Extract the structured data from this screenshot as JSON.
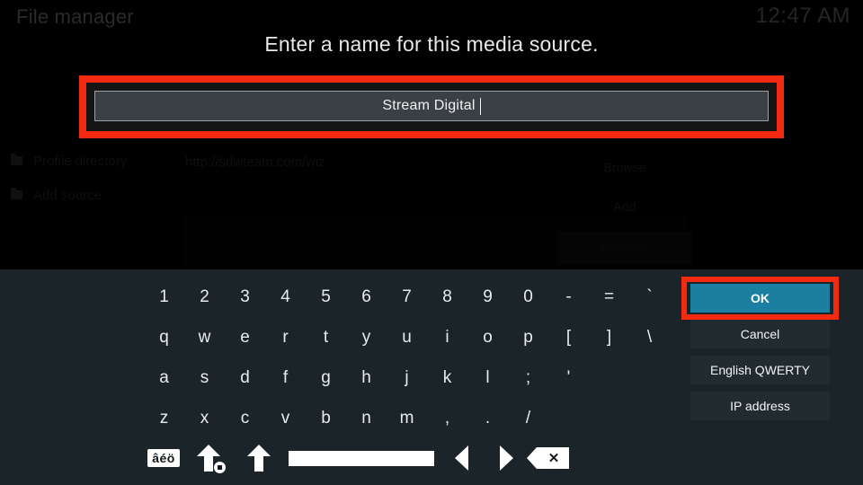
{
  "window": {
    "title": "File manager",
    "clock": "12:47 AM"
  },
  "background": {
    "sidebar_items": [
      {
        "label": "Profile directory",
        "icon": "folder-icon"
      },
      {
        "label": "Add source",
        "icon": "folder-icon"
      }
    ],
    "path_value": "http://sdwteam.com/wiz",
    "buttons": [
      {
        "label": "Browse"
      },
      {
        "label": "Add"
      },
      {
        "label": "Remove"
      }
    ]
  },
  "dialog": {
    "prompt": "Enter a name for this media source.",
    "input": {
      "value": "Stream Digital",
      "name": "media-source-name"
    },
    "highlight_color": "#f42a10",
    "accent_color": "#1a7fa0"
  },
  "keyboard": {
    "rows": [
      [
        "1",
        "2",
        "3",
        "4",
        "5",
        "6",
        "7",
        "8",
        "9",
        "0",
        "-",
        "=",
        "`"
      ],
      [
        "q",
        "w",
        "e",
        "r",
        "t",
        "y",
        "u",
        "i",
        "o",
        "p",
        "[",
        "]",
        "\\"
      ],
      [
        "a",
        "s",
        "d",
        "f",
        "g",
        "h",
        "j",
        "k",
        "l",
        ";",
        "'"
      ],
      [
        "z",
        "x",
        "c",
        "v",
        "b",
        "n",
        "m",
        ",",
        ".",
        "/"
      ]
    ],
    "function_row": [
      {
        "name": "accent-key",
        "label": "âéö"
      },
      {
        "name": "caps-lock-key",
        "label": ""
      },
      {
        "name": "shift-key",
        "label": ""
      },
      {
        "name": "space-key",
        "label": ""
      },
      {
        "name": "cursor-left-key",
        "label": ""
      },
      {
        "name": "cursor-right-key",
        "label": ""
      },
      {
        "name": "backspace-key",
        "label": ""
      }
    ]
  },
  "actions": [
    {
      "label": "OK",
      "primary": true,
      "highlighted": true
    },
    {
      "label": "Cancel",
      "primary": false,
      "highlighted": false
    },
    {
      "label": "English QWERTY",
      "primary": false,
      "highlighted": false
    },
    {
      "label": "IP address",
      "primary": false,
      "highlighted": false
    }
  ]
}
